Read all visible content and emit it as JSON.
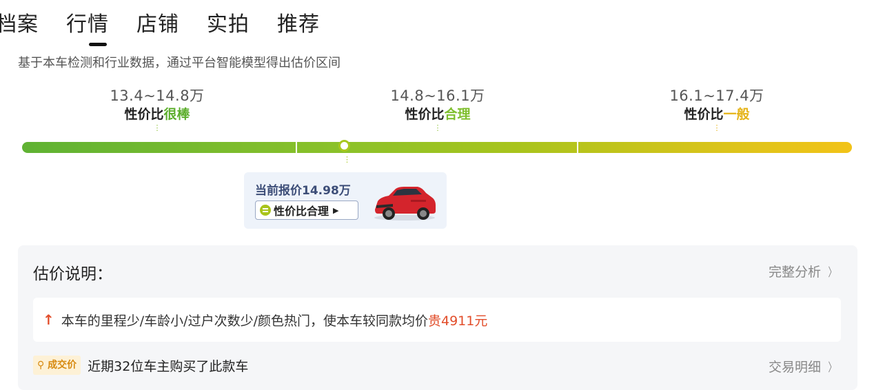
{
  "tabs": [
    {
      "label": "档案"
    },
    {
      "label": "行情"
    },
    {
      "label": "店铺"
    },
    {
      "label": "实拍"
    },
    {
      "label": "推荐"
    }
  ],
  "active_tab": "行情",
  "description": "基于本车检测和行业数据，通过平台智能模型得出估价区间",
  "ranges": [
    {
      "price": "13.4~14.8万",
      "verdict_prefix": "性价比",
      "verdict": "很棒",
      "color": "#5cae2c"
    },
    {
      "price": "14.8~16.1万",
      "verdict_prefix": "性价比",
      "verdict": "合理",
      "color": "#7fbf2e"
    },
    {
      "price": "16.1~17.4万",
      "verdict_prefix": "性价比",
      "verdict": "一般",
      "color": "#e5b316"
    }
  ],
  "current_quote": {
    "label": "当前报价14.98万",
    "badge": "性价比合理",
    "position_fraction": 0.39
  },
  "explanation": {
    "title": "估价说明：",
    "full_analysis_link": "完整分析",
    "reason_text": "本车的里程少/车龄小/过户次数少/颜色热门，使本车较同款均价",
    "reason_highlight": "贵4911元"
  },
  "deal": {
    "badge": "成交价",
    "text": "近期32位车主购买了此款车",
    "link": "交易明细"
  },
  "colors": {
    "accent_red": "#e24d2a",
    "bar_start": "#5fb233",
    "bar_end": "#f2c318"
  }
}
